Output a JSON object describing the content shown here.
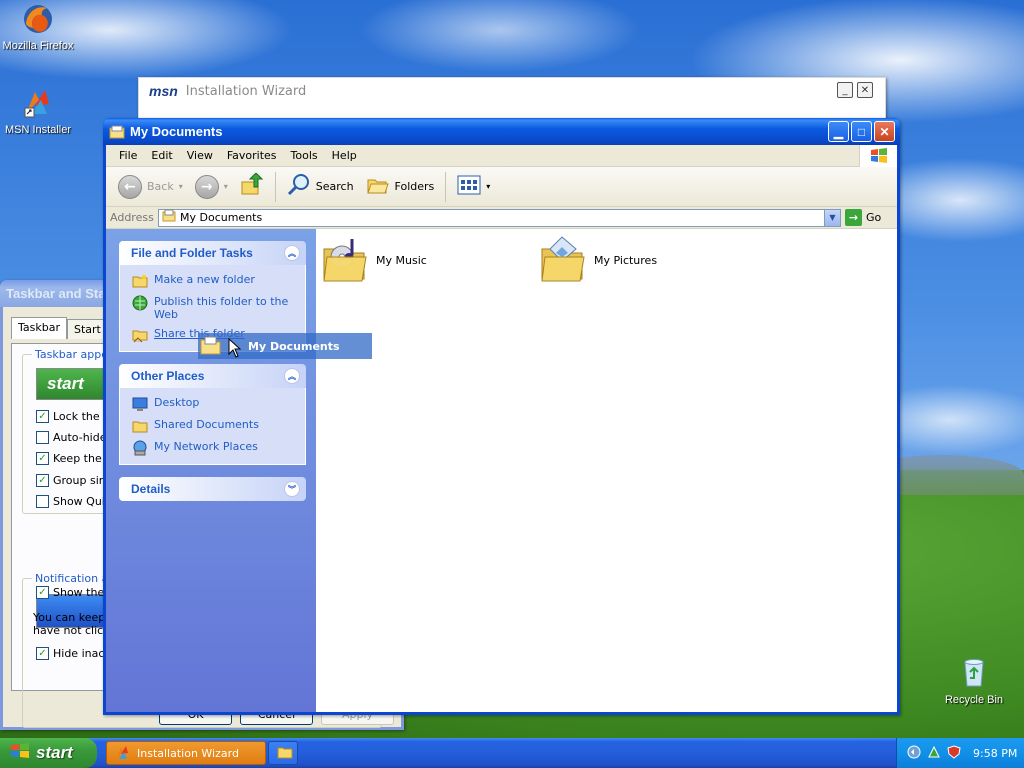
{
  "desktop": {
    "icons": [
      {
        "label": "Mozilla Firefox",
        "icon": "firefox-icon"
      },
      {
        "label": "MSN Installer",
        "icon": "msn-installer-icon"
      },
      {
        "label": "Recycle Bin",
        "icon": "recycle-bin-icon"
      }
    ]
  },
  "msn_wizard": {
    "logo": "msn",
    "title": "Installation Wizard",
    "min_label": "_",
    "close_label": "✕"
  },
  "taskbar_props": {
    "title": "Taskbar and Start Menu Properties",
    "tabs": [
      "Taskbar",
      "Start Menu"
    ],
    "group1_label": "Taskbar appearance",
    "preview_start": "start",
    "options": [
      {
        "label": "Lock the taskbar",
        "checked": true
      },
      {
        "label": "Auto-hide the taskbar",
        "checked": false
      },
      {
        "label": "Keep the taskbar on top of other windows",
        "checked": true
      },
      {
        "label": "Group similar taskbar buttons",
        "checked": true
      },
      {
        "label": "Show Quick Launch",
        "checked": false
      }
    ],
    "group2_label": "Notification area",
    "notif_options": [
      {
        "label": "Show the clock",
        "checked": true
      }
    ],
    "help_text_line1": "You can keep the notification area uncluttered by hiding icons that you",
    "help_text_line2": "have not clicked recently.",
    "hide_inactive": {
      "label": "Hide inactive icons",
      "checked": true
    },
    "buttons": [
      "OK",
      "Cancel",
      "Apply"
    ]
  },
  "window": {
    "title": "My Documents",
    "menu": [
      "File",
      "Edit",
      "View",
      "Favorites",
      "Tools",
      "Help"
    ],
    "toolbar": {
      "back": "Back",
      "search": "Search",
      "folders": "Folders"
    },
    "address": {
      "label": "Address",
      "value": "My Documents",
      "go": "Go"
    },
    "taskpane": {
      "panels": [
        {
          "title": "File and Folder Tasks",
          "items": [
            {
              "label": "Make a new folder",
              "icon": "new-folder-icon"
            },
            {
              "label": "Publish this folder to the Web",
              "icon": "publish-web-icon"
            },
            {
              "label": "Share this folder",
              "icon": "share-folder-icon"
            }
          ]
        },
        {
          "title": "Other Places",
          "items": [
            {
              "label": "Desktop",
              "icon": "desktop-icon"
            },
            {
              "label": "Shared Documents",
              "icon": "shared-documents-icon"
            },
            {
              "label": "My Network Places",
              "icon": "network-places-icon"
            }
          ]
        },
        {
          "title": "Details",
          "items": []
        }
      ]
    },
    "folders": [
      {
        "name": "My Music",
        "icon": "music-folder-icon"
      },
      {
        "name": "My Pictures",
        "icon": "pictures-folder-icon"
      }
    ],
    "drag_ghost_label": "My Documents"
  },
  "taskbar": {
    "start_label": "start",
    "tasks": [
      {
        "label": "Installation Wizard",
        "active": true
      },
      {
        "label": "",
        "active": false
      }
    ],
    "clock": "9:58 PM"
  },
  "colors": {
    "xp_blue": "#0a46d0",
    "taskpane_link": "#215dc6",
    "start_green": "#3a9a3a"
  }
}
